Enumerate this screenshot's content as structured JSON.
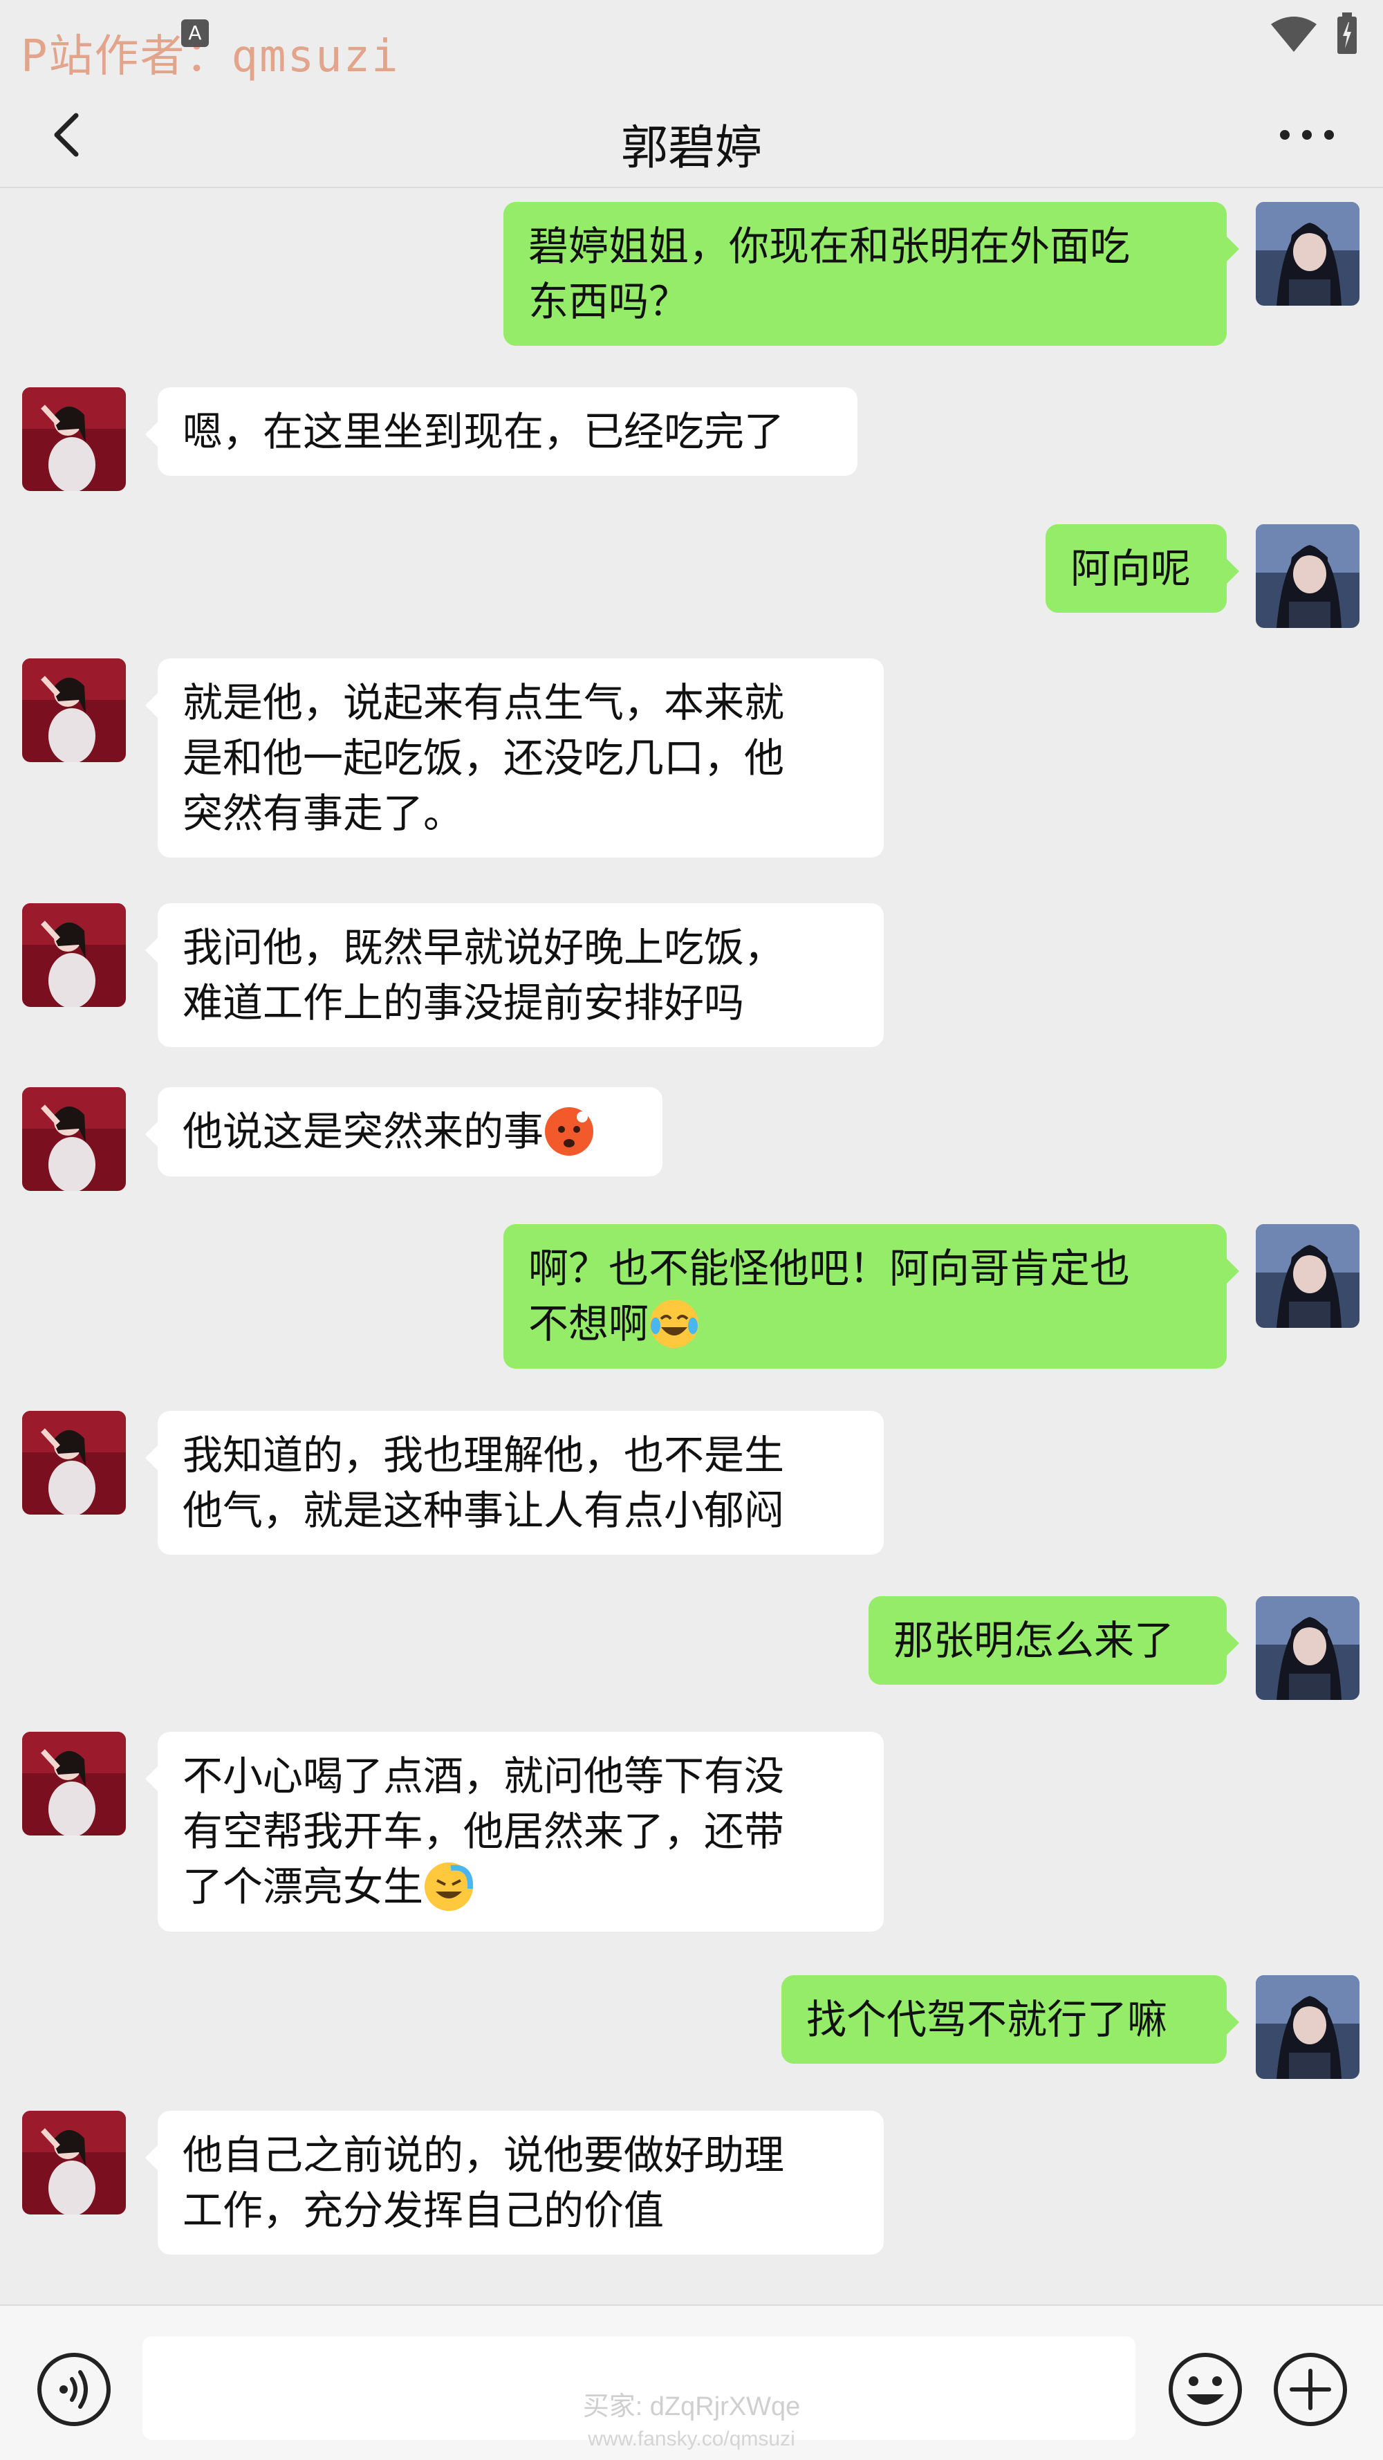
{
  "watermark_top": "P站作者：qmsuzi",
  "status_bar": {
    "signal_icon": "wifi-icon",
    "battery_icon": "battery-icon",
    "notice_icon": "A"
  },
  "header": {
    "title": "郭碧婷",
    "back_icon": "back-arrow-icon",
    "more_icon": "more-dots-icon"
  },
  "messages": [
    {
      "side": "right",
      "lines": [
        "碧婷姐姐，你现在和张明在外面吃",
        "东西吗？"
      ]
    },
    {
      "side": "left",
      "lines": [
        "嗯，在这里坐到现在，已经吃完了"
      ]
    },
    {
      "side": "right",
      "lines": [
        "阿向呢"
      ]
    },
    {
      "side": "left",
      "lines": [
        "就是他，说起来有点生气，本来就",
        "是和他一起吃饭，还没吃几口，他",
        "突然有事走了。"
      ]
    },
    {
      "side": "left",
      "lines": [
        "我问他，既然早就说好晚上吃饭，",
        "难道工作上的事没提前安排好吗"
      ]
    },
    {
      "side": "left",
      "lines": [
        "他说这是突然来的事"
      ],
      "emoji": "angry-face-emoji"
    },
    {
      "side": "right",
      "lines": [
        "啊？也不能怪他吧！阿向哥肯定也",
        "不想啊"
      ],
      "emoji": "tears-of-joy-emoji"
    },
    {
      "side": "left",
      "lines": [
        "我知道的，我也理解他，也不是生",
        "他气，就是这种事让人有点小郁闷"
      ]
    },
    {
      "side": "right",
      "lines": [
        "那张明怎么来了"
      ]
    },
    {
      "side": "left",
      "lines": [
        "不小心喝了点酒，就问他等下有没",
        "有空帮我开车，他居然来了，还带",
        "了个漂亮女生"
      ],
      "emoji": "crying-laughing-emoji"
    },
    {
      "side": "right",
      "lines": [
        "找个代驾不就行了嘛"
      ]
    },
    {
      "side": "left",
      "lines": [
        "他自己之前说的，说他要做好助理",
        "工作，充分发挥自己的价值"
      ]
    }
  ],
  "footer": {
    "voice_icon": "voice-input-icon",
    "emoji_icon": "smiley-icon",
    "plus_icon": "plus-icon",
    "watermark_line1": "买家: dZqRjrXWqe",
    "watermark_line2": "www.fansky.co/qmsuzi"
  },
  "colors": {
    "background": "#ededed",
    "sent_bubble": "#95ec69",
    "received_bubble": "#ffffff",
    "watermark": "#e2a48a"
  }
}
